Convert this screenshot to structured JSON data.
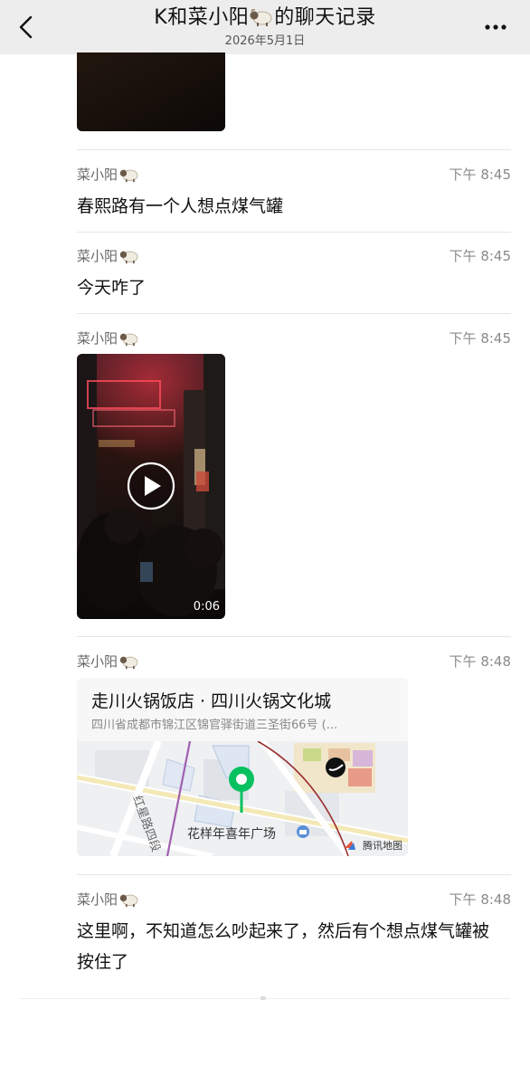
{
  "header": {
    "title_prefix": "K和菜小阳",
    "title_suffix": "的聊天记录",
    "date": "2026年5月1日",
    "back_icon": "chevron-left-icon",
    "more_icon": "more-horizontal-icon"
  },
  "messages": [
    {
      "sender": "菜小阳",
      "time": "下午 8:45",
      "type": "text",
      "text": "春熙路有一个人想点煤气罐"
    },
    {
      "sender": "菜小阳",
      "time": "下午 8:45",
      "type": "text",
      "text": "今天咋了"
    },
    {
      "sender": "菜小阳",
      "time": "下午 8:45",
      "type": "video",
      "duration": "0:06"
    },
    {
      "sender": "菜小阳",
      "time": "下午 8:48",
      "type": "location",
      "location": {
        "title": "走川火锅饭店 · 四川火锅文化城",
        "address": "四川省成都市锦江区锦官驿街道三圣街66号 (...",
        "landmark": "花样年喜年广场",
        "provider": "腾讯地图"
      }
    },
    {
      "sender": "菜小阳",
      "time": "下午 8:48",
      "type": "text",
      "text": "这里啊，不知道怎么吵起来了，然后有个想点煤气罐被按住了"
    }
  ],
  "colors": {
    "header_bg": "#ededed",
    "pin_green": "#07c160",
    "time_gray": "#8a8a8a"
  }
}
